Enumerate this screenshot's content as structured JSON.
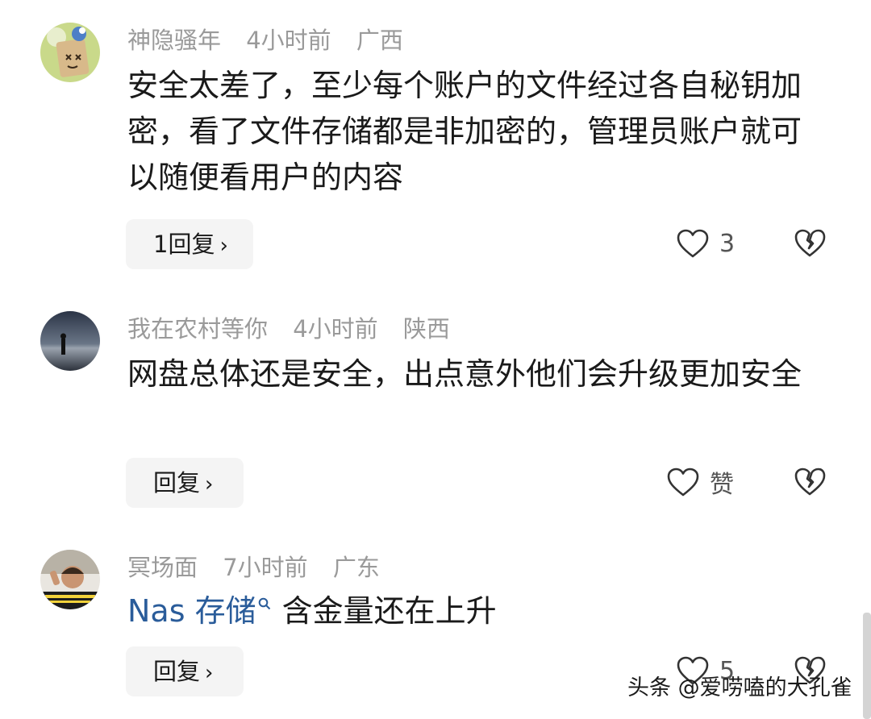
{
  "comments": [
    {
      "username": "神隐骚年",
      "time": "4小时前",
      "location": "广西",
      "text": "安全太差了，至少每个账户的文件经过各自秘钥加密，看了文件存储都是非加密的，管理员账户就可以随便看用户的内容",
      "reply_label": "1回复",
      "like_label": "3",
      "avatar_icon": "cartoon-avatar-icon"
    },
    {
      "username": "我在农村等你",
      "time": "4小时前",
      "location": "陕西",
      "text": "网盘总体还是安全，出点意外他们会升级更加安全",
      "reply_label": "回复",
      "like_label": "赞",
      "avatar_icon": "silhouette-avatar-icon"
    },
    {
      "username": "冥场面",
      "time": "7小时前",
      "location": "广东",
      "text_link": "Nas 存储",
      "text_rest": "含金量还在上升",
      "reply_label": "回复",
      "like_label": "5",
      "avatar_icon": "photo-avatar-icon"
    }
  ],
  "reply_chevron": "›",
  "watermark": "头条 @爱唠嗑的大孔雀",
  "colors": {
    "meta_gray": "#9a9a9a",
    "link_blue": "#2a5c9a",
    "button_bg": "#f4f4f4",
    "text": "#1a1a1a"
  }
}
